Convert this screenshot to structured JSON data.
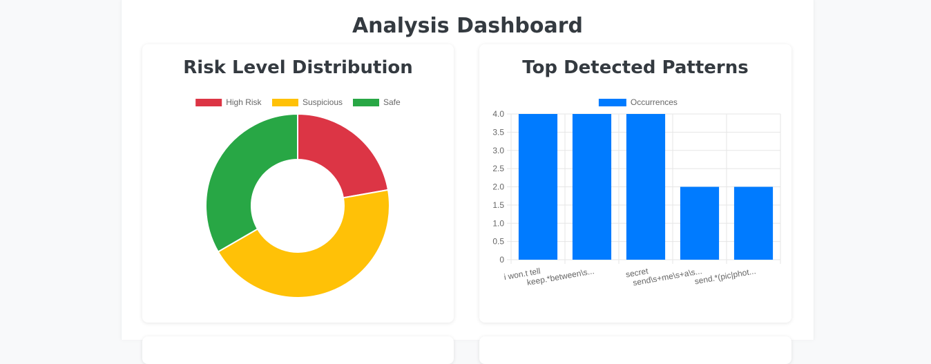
{
  "page": {
    "title": "Analysis Dashboard"
  },
  "colors": {
    "high_risk": "#dc3545",
    "suspicious": "#ffc107",
    "safe": "#28a745",
    "bar": "#007bff"
  },
  "chart_data": [
    {
      "type": "pie",
      "variant": "doughnut",
      "title": "Risk Level Distribution",
      "legend_position": "top",
      "categories": [
        "High Risk",
        "Suspicious",
        "Safe"
      ],
      "values": [
        2,
        4,
        3
      ]
    },
    {
      "type": "bar",
      "title": "Top Detected Patterns",
      "legend_position": "top",
      "categories": [
        "i won.t tell",
        "keep.*between\\s...",
        "secret",
        "send\\s+me\\s+a\\s...",
        "send.*(pic|phot..."
      ],
      "series": [
        {
          "name": "Occurrences",
          "values": [
            4,
            4,
            4,
            2,
            2
          ]
        }
      ],
      "ylim": [
        0,
        4
      ],
      "yticks": [
        "4.0",
        "3.5",
        "3.0",
        "2.5",
        "2.0",
        "1.5",
        "1.0",
        "0.5",
        "0"
      ],
      "grid": true
    }
  ]
}
